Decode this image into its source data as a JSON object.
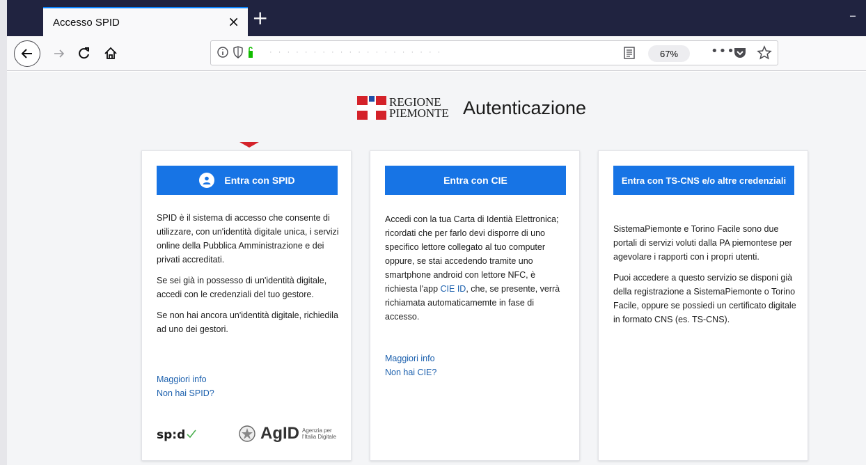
{
  "browser": {
    "tab_title": "Accesso SPID",
    "tab_close": "×",
    "new_tab": "+",
    "window_minimize": "–",
    "url_masked": "· · · · · · · · · · · · · · · · · · · ·",
    "zoom": "67%",
    "more": "•••",
    "accent_color": "#0a84ff"
  },
  "header": {
    "logo_line1": "REGIONE",
    "logo_line2": "PIEMONTE",
    "title": "Autenticazione"
  },
  "spid": {
    "button_label": "Entra con SPID",
    "p1": "SPID è il sistema di accesso che consente di utilizzare, con un'identità digitale unica, i servizi online della Pubblica Amministrazione e dei privati accreditati.",
    "p2": "Se sei già in possesso di un'identità digitale, accedi con le credenziali del tuo gestore.",
    "p3": "Se non hai ancora un'identità digitale, richiedila ad uno dei gestori.",
    "link_info": "Maggiori info",
    "link_no": "Non hai SPID?",
    "logo_spid": "sp:d",
    "logo_agid": "AgID",
    "agid_sub1": "Agenzia per",
    "agid_sub2": "l'Italia Digitale"
  },
  "cie": {
    "button_label": "Entra con CIE",
    "p1_before": "Accedi con la tua Carta di Identià Elettronica; ricordati che per farlo devi disporre di uno specifico lettore collegato al tuo computer oppure, se stai accedendo tramite uno smartphone android con lettore NFC, è richiesta l'app ",
    "p1_link": "CIE ID",
    "p1_after": ", che, se presente, verrà richiamata automaticamemte in fase di accesso.",
    "link_info": "Maggiori info",
    "link_no": "Non hai CIE?"
  },
  "cns": {
    "button_label": "Entra con TS-CNS e/o altre credenziali",
    "p1": "SistemaPiemonte e Torino Facile sono due portali di servizi voluti dalla PA piemontese per agevolare i rapporti con i propri utenti.",
    "p2": "Puoi accedere a questo servizio se disponi già della registrazione a SistemaPiemonte o Torino Facile, oppure se possiedi un certificato digitale in formato CNS (es. TS-CNS)."
  },
  "colors": {
    "primary_button": "#1774e5",
    "link": "#1a5fad",
    "page_bg": "#f4f5f7"
  }
}
